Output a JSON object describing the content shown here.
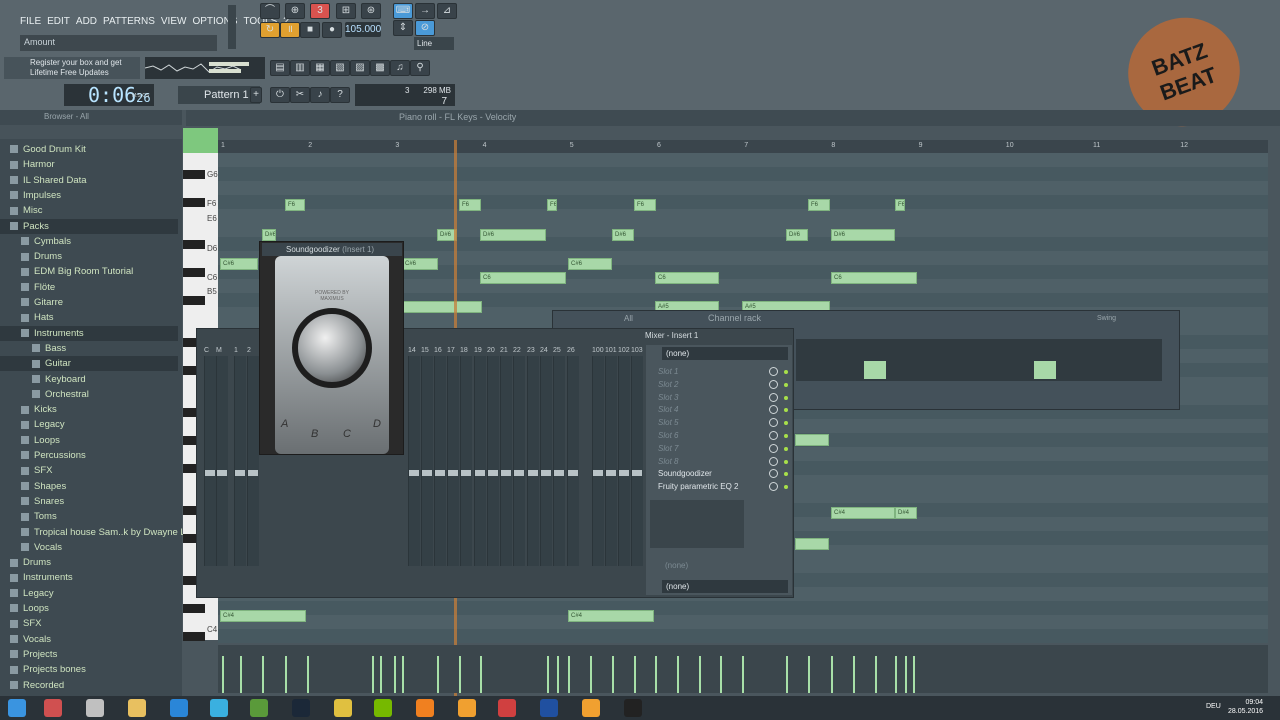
{
  "menu": [
    "FILE",
    "EDIT",
    "ADD",
    "PATTERNS",
    "VIEW",
    "OPTIONS",
    "TOOLS",
    "?"
  ],
  "hint": "Amount",
  "tempo": "105.000",
  "snap_mode": "Line",
  "register": [
    "Register your box and get",
    "Lifetime Free Updates"
  ],
  "time": {
    "value": "0:06",
    "sub": "26",
    "unit": "M:S:CS"
  },
  "pattern": "Pattern 1",
  "cpu": {
    "cores": "3",
    "mem": "298 MB",
    "poly": "7"
  },
  "logo": [
    "BATZ",
    "BEAT"
  ],
  "browser": {
    "header": "Browser - All",
    "items": [
      {
        "label": "Good Drum Kit",
        "level": 1
      },
      {
        "label": "Harmor",
        "level": 1
      },
      {
        "label": "IL Shared Data",
        "level": 1
      },
      {
        "label": "Impulses",
        "level": 1
      },
      {
        "label": "Misc",
        "level": 1
      },
      {
        "label": "Packs",
        "level": 1,
        "selected": true
      },
      {
        "label": "Cymbals",
        "level": 2
      },
      {
        "label": "Drums",
        "level": 2
      },
      {
        "label": "EDM Big Room Tutorial",
        "level": 2
      },
      {
        "label": "Flöte",
        "level": 2
      },
      {
        "label": "Gitarre",
        "level": 2
      },
      {
        "label": "Hats",
        "level": 2
      },
      {
        "label": "Instruments",
        "level": 2,
        "selected": true
      },
      {
        "label": "Bass",
        "level": 3
      },
      {
        "label": "Guitar",
        "level": 3,
        "selected": true
      },
      {
        "label": "Keyboard",
        "level": 3
      },
      {
        "label": "Orchestral",
        "level": 3
      },
      {
        "label": "Kicks",
        "level": 2
      },
      {
        "label": "Legacy",
        "level": 2
      },
      {
        "label": "Loops",
        "level": 2
      },
      {
        "label": "Percussions",
        "level": 2
      },
      {
        "label": "SFX",
        "level": 2
      },
      {
        "label": "Shapes",
        "level": 2
      },
      {
        "label": "Snares",
        "level": 2
      },
      {
        "label": "Toms",
        "level": 2
      },
      {
        "label": "Tropical house Sam..k by Dwayne Lewis",
        "level": 2
      },
      {
        "label": "Vocals",
        "level": 2
      },
      {
        "label": "Drums",
        "level": 1
      },
      {
        "label": "Instruments",
        "level": 1
      },
      {
        "label": "Legacy",
        "level": 1
      },
      {
        "label": "Loops",
        "level": 1
      },
      {
        "label": "SFX",
        "level": 1
      },
      {
        "label": "Vocals",
        "level": 1
      },
      {
        "label": "Projects",
        "level": 1
      },
      {
        "label": "Projects bones",
        "level": 1
      },
      {
        "label": "Recorded",
        "level": 1
      },
      {
        "label": "Rendered",
        "level": 1
      }
    ]
  },
  "piano_roll": {
    "title": "Piano roll - FL Keys",
    "target": "Velocity",
    "bars": [
      "1",
      "2",
      "3",
      "4",
      "5",
      "6",
      "7",
      "8",
      "9",
      "10",
      "11",
      "12"
    ],
    "key_labels": [
      "G6",
      "F6",
      "E6",
      "D6",
      "C6",
      "B5",
      "C4"
    ],
    "notes": [
      {
        "label": "F6",
        "x": 0
      },
      {
        "label": "F6",
        "x": 1
      },
      {
        "label": "F6",
        "x": 2
      },
      {
        "label": "F6",
        "x": 3
      },
      {
        "label": "F6",
        "x": 4
      },
      {
        "label": "F6",
        "x": 5
      },
      {
        "label": "D#6",
        "x": 6
      },
      {
        "label": "D#6",
        "x": 7
      },
      {
        "label": "D#6",
        "x": 8
      },
      {
        "label": "D#6",
        "x": 9
      },
      {
        "label": "D#6",
        "x": 10
      },
      {
        "label": "D#6",
        "x": 11
      },
      {
        "label": "C#6",
        "x": 12
      },
      {
        "label": "C#6",
        "x": 13
      },
      {
        "label": "C#6",
        "x": 14
      },
      {
        "label": "C6",
        "x": 15
      },
      {
        "label": "C6",
        "x": 16
      },
      {
        "label": "C6",
        "x": 17
      },
      {
        "label": "A#5",
        "x": 18
      },
      {
        "label": "A#5",
        "x": 19
      },
      {
        "label": "C#4",
        "x": 20
      },
      {
        "label": "D#4",
        "x": 21
      },
      {
        "label": "C#4",
        "x": 22
      },
      {
        "label": "C#4",
        "x": 23
      }
    ]
  },
  "soundgoodizer": {
    "title": "Soundgoodizer",
    "insert": "(Insert 1)",
    "brand": "POWERED BY MAXIMUS",
    "modes": [
      "A",
      "B",
      "C",
      "D"
    ]
  },
  "mixer": {
    "title": "Mixer - Insert 1",
    "channel_numbers": [
      "C",
      "M",
      "1",
      "2",
      "14",
      "15",
      "16",
      "17",
      "18",
      "19",
      "20",
      "21",
      "22",
      "23",
      "24",
      "25",
      "26",
      "100",
      "101",
      "102",
      "103"
    ],
    "input": "(none)",
    "slots": [
      "Slot 1",
      "Slot 2",
      "Slot 3",
      "Slot 4",
      "Slot 5",
      "Slot 6",
      "Slot 7",
      "Slot 8",
      "Soundgoodizer",
      "Fruity parametric EQ 2"
    ],
    "dim_none": "(none)",
    "output": "(none)"
  },
  "channel_rack": {
    "title": "Channel rack",
    "filter": "All",
    "swing": "Swing"
  },
  "taskbar": {
    "lang": "DEU",
    "time": "09:04",
    "date": "28.05.2016"
  }
}
